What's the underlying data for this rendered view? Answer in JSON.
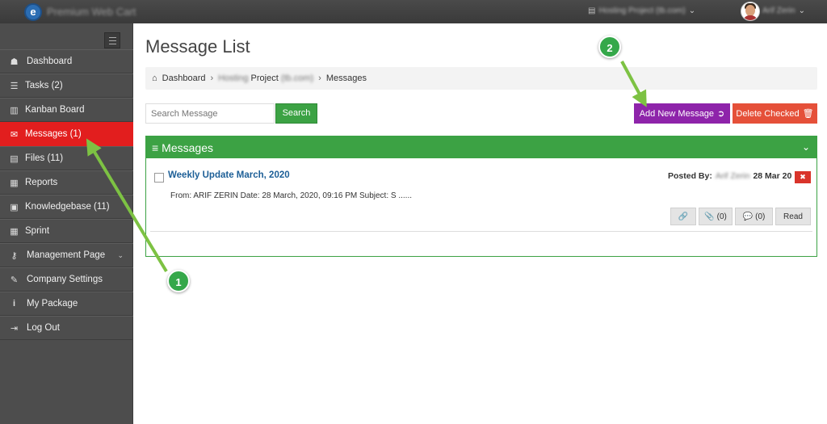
{
  "topbar": {
    "brand": "Premium Web Cart",
    "project": "Hosting Project (tb.com)",
    "user": "Arif Zerin"
  },
  "sidebar": {
    "items": [
      {
        "label": "Dashboard",
        "icon": "dashboard-icon"
      },
      {
        "label": "Tasks (2)",
        "icon": "tasks-icon"
      },
      {
        "label": "Kanban Board",
        "icon": "kanban-icon"
      },
      {
        "label": "Messages (1)",
        "icon": "envelope-icon"
      },
      {
        "label": "Files (11)",
        "icon": "file-icon"
      },
      {
        "label": "Reports",
        "icon": "bar-chart-icon"
      },
      {
        "label": "Knowledgebase (11)",
        "icon": "book-icon"
      },
      {
        "label": "Sprint",
        "icon": "calendar-icon"
      },
      {
        "label": "Management Page",
        "icon": "key-icon"
      },
      {
        "label": "Company Settings",
        "icon": "wrench-icon"
      },
      {
        "label": "My Package",
        "icon": "info-icon"
      },
      {
        "label": "Log Out",
        "icon": "logout-icon"
      }
    ]
  },
  "page": {
    "title": "Message List",
    "breadcrumb": {
      "home": "Dashboard",
      "project_prefix": "Hosting",
      "project": "Project",
      "project_suffix": "(tb.com)",
      "current": "Messages"
    }
  },
  "toolbar": {
    "search_placeholder": "Search Message",
    "search_label": "Search",
    "add_label": "Add New Message",
    "delete_label": "Delete Checked"
  },
  "panel": {
    "title": "Messages",
    "messages": [
      {
        "subject": "Weekly Update March, 2020",
        "posted_by_label": "Posted By:",
        "author": "Arif Zerin",
        "date": "28 Mar 20",
        "snippet": "From: ARIF ZERIN Date: 28 March, 2020, 09:16 PM Subject: S ......",
        "attachments": "(0)",
        "comments": "(0)",
        "read_label": "Read"
      }
    ]
  },
  "annotations": {
    "step1": "1",
    "step2": "2"
  },
  "colors": {
    "active_nav": "#e21e1e",
    "primary_green": "#3ca244",
    "add_button": "#8e24aa",
    "delete_button": "#e55039",
    "arrow": "#7dc243"
  }
}
